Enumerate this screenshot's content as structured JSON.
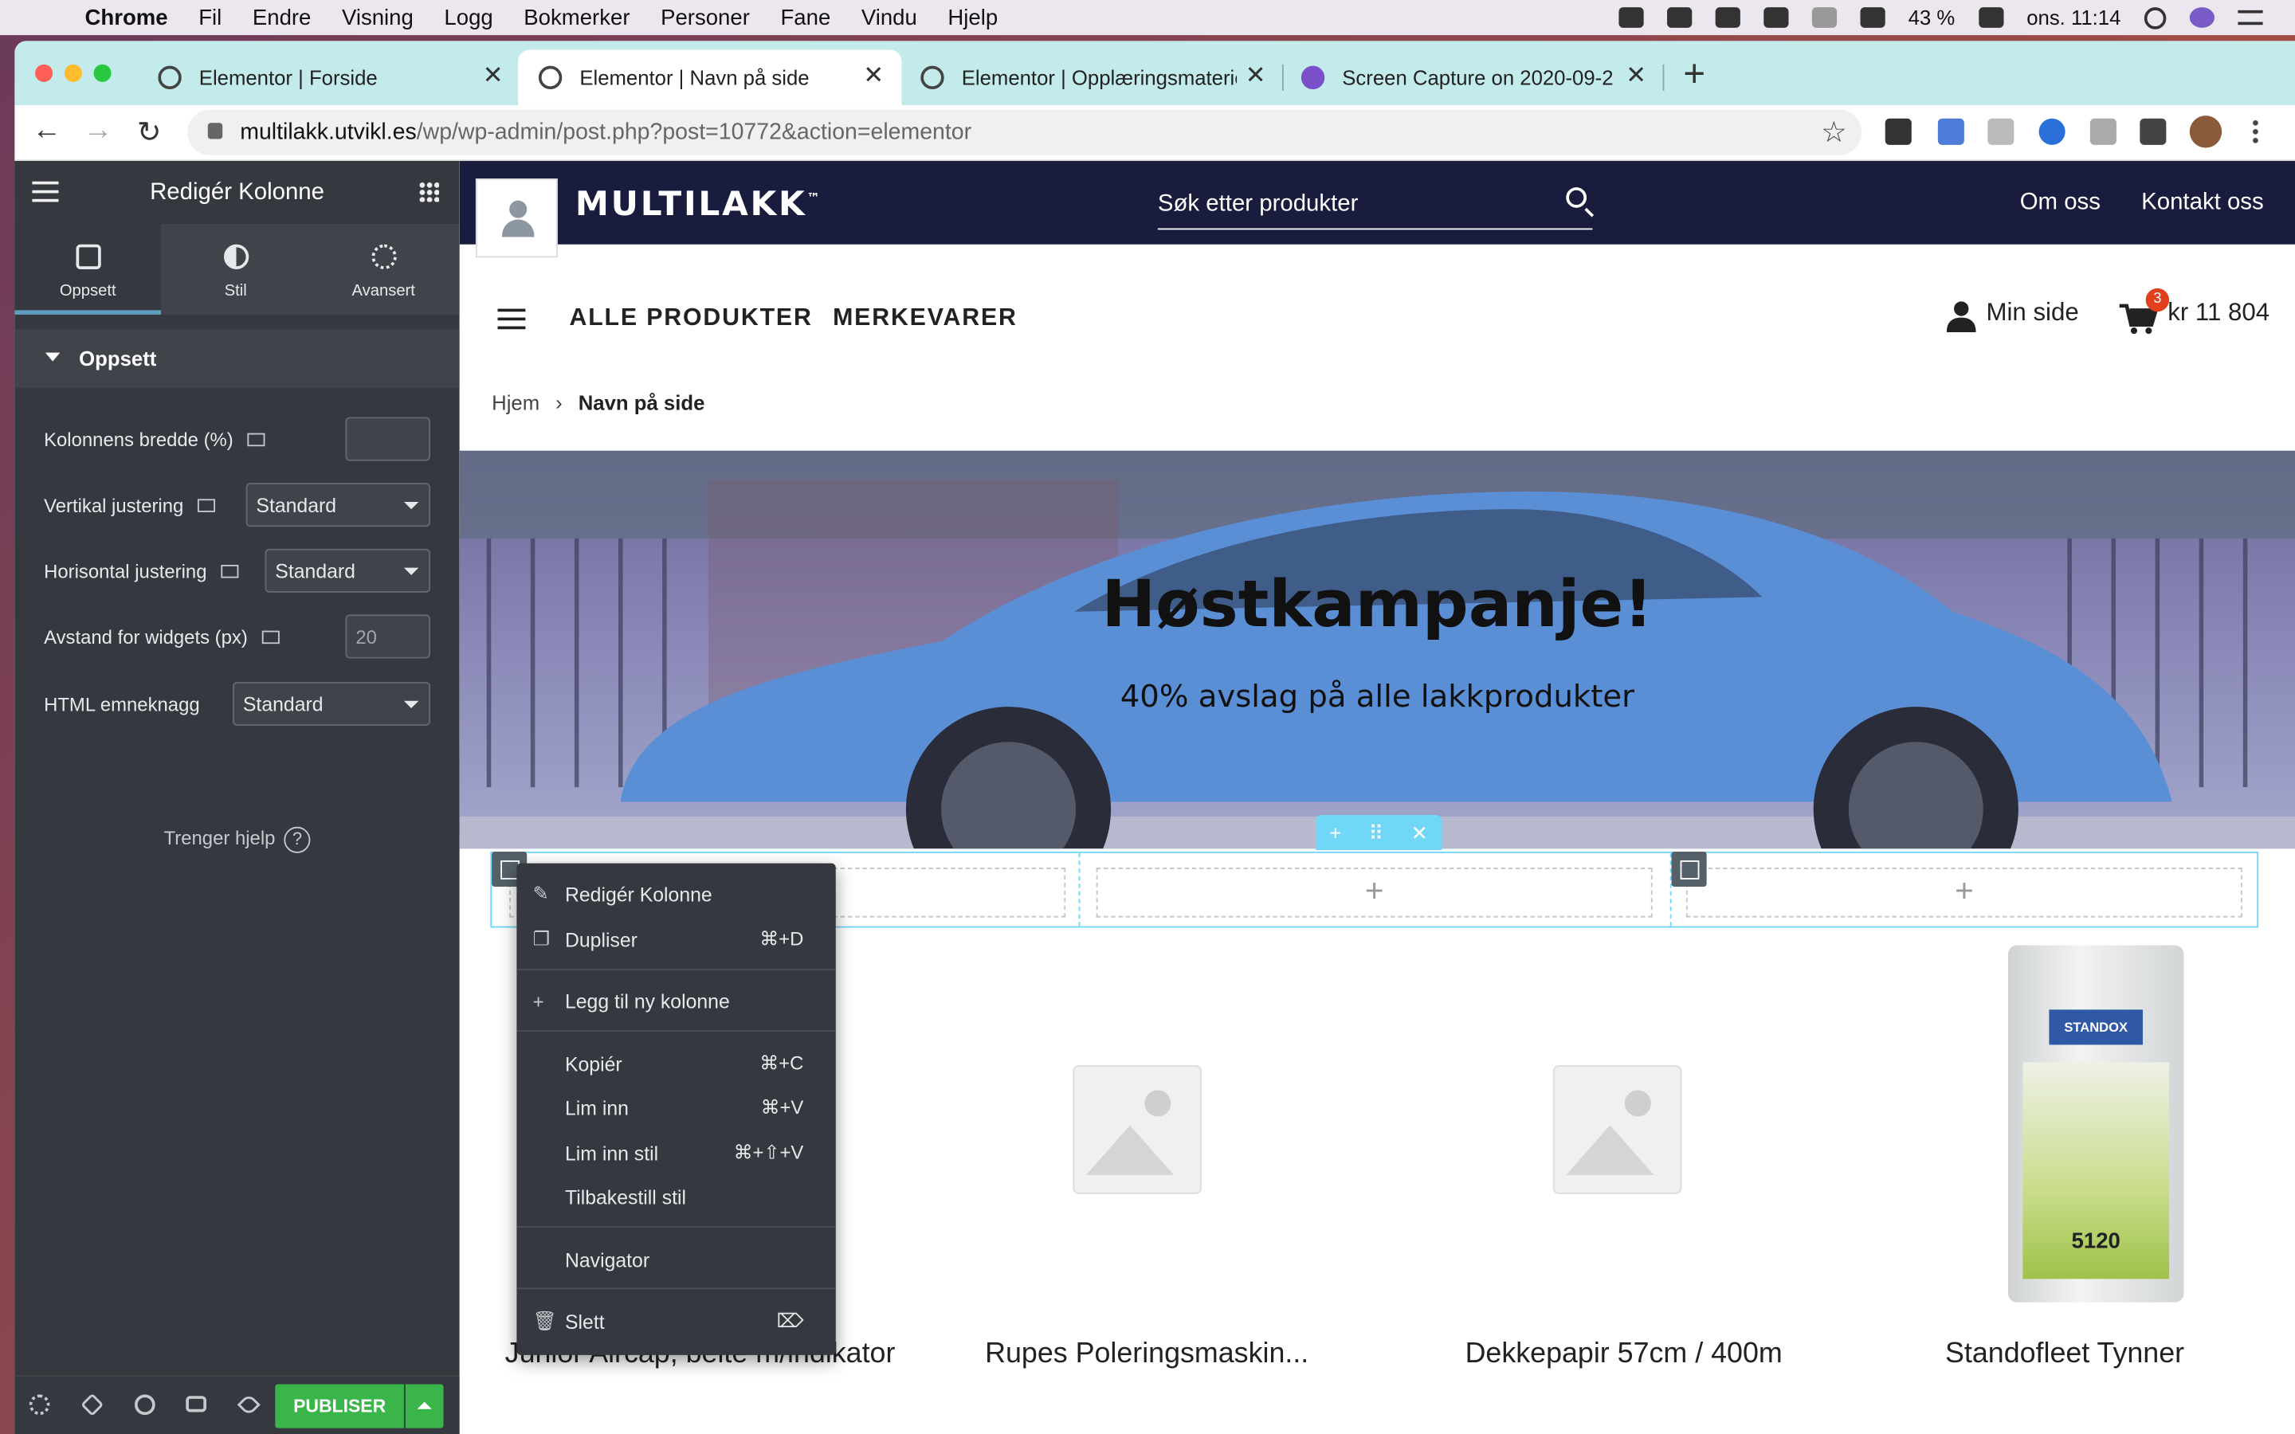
{
  "menubar": {
    "app": "Chrome",
    "items": [
      "Fil",
      "Endre",
      "Visning",
      "Logg",
      "Bokmerker",
      "Personer",
      "Fane",
      "Vindu",
      "Hjelp"
    ],
    "battery": "43 %",
    "datetime": "ons. 11:14"
  },
  "tabs": [
    {
      "title": "Elementor | Forside"
    },
    {
      "title": "Elementor | Navn på side"
    },
    {
      "title": "Elementor | Opplæringsmateriell"
    },
    {
      "title": "Screen Capture on 2020-09-2"
    }
  ],
  "address": {
    "domain": "multilakk.utvikl.es",
    "path": "/wp/wp-admin/post.php?post=10772&action=elementor"
  },
  "panel": {
    "title": "Redigér Kolonne",
    "tabs": [
      "Oppsett",
      "Stil",
      "Avansert"
    ],
    "section": "Oppsett",
    "controls": {
      "width_label": "Kolonnens bredde (%)",
      "valign_label": "Vertikal justering",
      "valign_value": "Standard",
      "halign_label": "Horisontal justering",
      "halign_value": "Standard",
      "gap_label": "Avstand for widgets (px)",
      "gap_placeholder": "20",
      "html_label": "HTML emneknagg",
      "html_value": "Standard"
    },
    "help": "Trenger hjelp",
    "help_icon": "?",
    "publish": "PUBLISER"
  },
  "site": {
    "brand": "MULTILAKK",
    "brand_mark": "™",
    "search_placeholder": "Søk etter produkter",
    "top_links": [
      "Om oss",
      "Kontakt oss"
    ],
    "nav": [
      "ALLE PRODUKTER",
      "MERKEVARER"
    ],
    "account": "Min side",
    "cart_count": "3",
    "cart_total": "kr 11 804",
    "breadcrumb": {
      "home": "Hjem",
      "sep": "›",
      "current": "Navn på side"
    },
    "hero": {
      "title": "Høstkampanje!",
      "subtitle": "40% avslag på alle lakkprodukter"
    },
    "products": [
      {
        "title": "Junior Aircap, belte m/indikator"
      },
      {
        "title": "Rupes Poleringsmaskin..."
      },
      {
        "title": "Dekkepapir 57cm / 400m"
      },
      {
        "title": "Standofleet Tynner"
      }
    ],
    "product_label": {
      "brand": "STANDOX",
      "number": "5120"
    }
  },
  "context_menu": [
    {
      "label": "Redigér Kolonne",
      "shortcut": ""
    },
    {
      "label": "Dupliser",
      "shortcut": "⌘+D"
    },
    {
      "label": "Legg til ny kolonne",
      "shortcut": ""
    },
    {
      "label": "Kopiér",
      "shortcut": "⌘+C"
    },
    {
      "label": "Lim inn",
      "shortcut": "⌘+V"
    },
    {
      "label": "Lim inn stil",
      "shortcut": "⌘+⇧+V"
    },
    {
      "label": "Tilbakestill stil",
      "shortcut": ""
    },
    {
      "label": "Navigator",
      "shortcut": ""
    },
    {
      "label": "Slett",
      "shortcut": "⌦"
    }
  ]
}
